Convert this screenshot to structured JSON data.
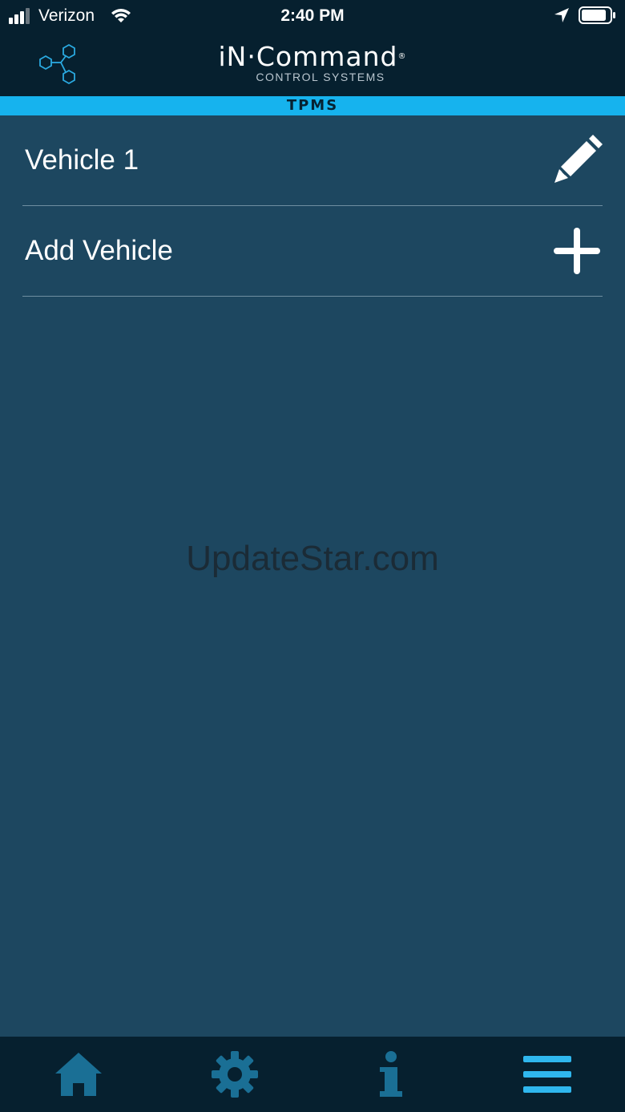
{
  "status_bar": {
    "carrier": "Verizon",
    "time": "2:40 PM",
    "icons": [
      "signal-icon",
      "wifi-icon",
      "location-arrow-icon",
      "battery-icon"
    ]
  },
  "header": {
    "brand": "iN·Command",
    "brand_mark": "®",
    "subtitle": "CONTROL SYSTEMS",
    "logo_icon": "hexagon-network-icon"
  },
  "banner": {
    "title": "TPMS"
  },
  "list": {
    "items": [
      {
        "label": "Vehicle 1",
        "action_icon": "pencil-edit-icon"
      },
      {
        "label": "Add Vehicle",
        "action_icon": "plus-icon"
      }
    ]
  },
  "watermark": "UpdateStar.com",
  "tab_bar": {
    "tabs": [
      {
        "icon": "home-icon"
      },
      {
        "icon": "gear-icon"
      },
      {
        "icon": "info-icon"
      },
      {
        "icon": "menu-icon"
      }
    ]
  },
  "colors": {
    "background": "#1d4760",
    "header": "#06202f",
    "accent": "#16b3ee",
    "tab_icon_inactive": "#1a6f95",
    "tab_icon_active": "#2fb7ee"
  }
}
